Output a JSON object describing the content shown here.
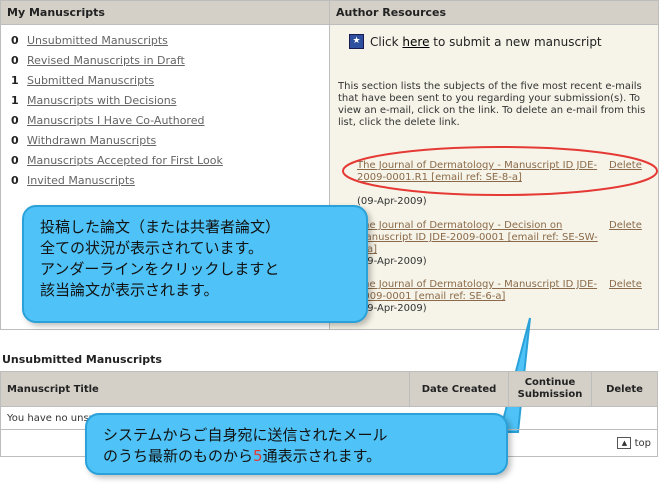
{
  "my_manuscripts": {
    "header": "My Manuscripts",
    "items": [
      {
        "count": "0",
        "label": "Unsubmitted Manuscripts"
      },
      {
        "count": "0",
        "label": "Revised Manuscripts in Draft"
      },
      {
        "count": "1",
        "label": "Submitted Manuscripts"
      },
      {
        "count": "1",
        "label": "Manuscripts with Decisions"
      },
      {
        "count": "0",
        "label": "Manuscripts I Have Co-Authored"
      },
      {
        "count": "0",
        "label": "Withdrawn Manuscripts"
      },
      {
        "count": "0",
        "label": "Manuscripts Accepted for First Look"
      },
      {
        "count": "0",
        "label": "Invited Manuscripts"
      }
    ]
  },
  "author_resources": {
    "header": "Author Resources",
    "submit_prefix": "Click ",
    "submit_link": "here",
    "submit_suffix": " to submit a new manuscript",
    "description": "This section lists the subjects of the five most recent e-mails that have been sent to you regarding your submission(s). To view an e-mail, click on the link. To delete an e-mail from this list, click the delete link.",
    "emails": [
      {
        "subject": "The Journal of Dermatology - Manuscript ID JDE-2009-0001.R1 [email ref: SE-8-a]",
        "date": "(09-Apr-2009)",
        "delete": "Delete"
      },
      {
        "subject": "The Journal of Dermatology - Decision on Manuscript ID JDE-2009-0001 [email ref: SE-SW-2-a]",
        "date": "(09-Apr-2009)",
        "delete": "Delete"
      },
      {
        "subject": "The Journal of Dermatology - Manuscript ID JDE-2009-0001 [email ref: SE-6-a]",
        "date": "(09-Apr-2009)",
        "delete": "Delete"
      }
    ]
  },
  "unsubmitted": {
    "title": "Unsubmitted Manuscripts",
    "columns": [
      "Manuscript Title",
      "Date Created",
      "Continue Submission",
      "Delete"
    ],
    "empty_text": "You have no unsubmitted manuscripts.",
    "top_label": "top"
  },
  "callouts": {
    "left": [
      "投稿した論文（または共著者論文）",
      "全ての状況が表示されています。",
      "アンダーラインをクリックしますと",
      "該当論文が表示されます。"
    ],
    "bottom_line1": "システムからご自身宛に送信されたメール",
    "bottom_line2_pre": "のうち最新のものから",
    "bottom_num": "5",
    "bottom_line2_post": "通表示されます。"
  }
}
